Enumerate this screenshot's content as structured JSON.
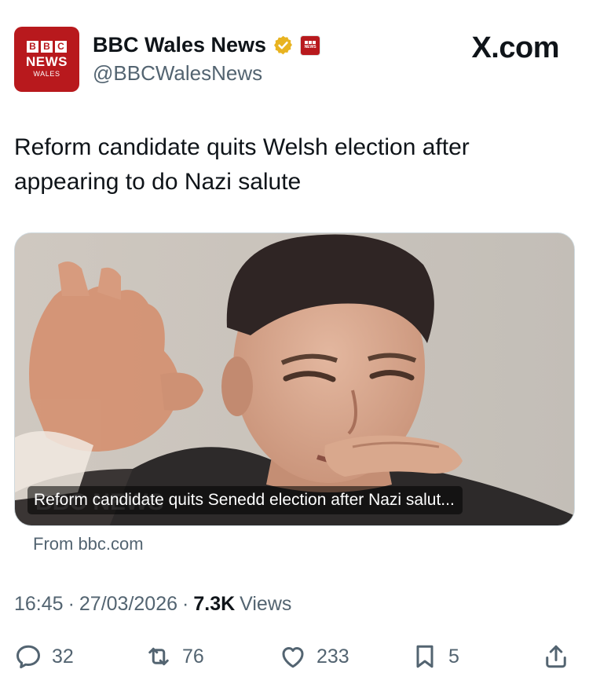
{
  "account": {
    "avatar_blocks": [
      "B",
      "B",
      "C"
    ],
    "avatar_news": "NEWS",
    "avatar_region": "WALES",
    "name": "BBC Wales News",
    "handle": "@BBCWalesNews",
    "verified_icon": "verified-badge-icon",
    "verified_color": "#e8b320",
    "affiliate_label": "NEWS"
  },
  "watermark": "X.com",
  "tweet": {
    "text": "Reform candidate quits Welsh election after appearing to do Nazi salute"
  },
  "link_card": {
    "caption": "Reform candidate quits Senedd election after Nazi salut...",
    "source": "From bbc.com"
  },
  "meta": {
    "time": "16:45",
    "sep1": "·",
    "date": "27/03/2026",
    "sep2": "·",
    "views_count": "7.3K",
    "views_label": "Views"
  },
  "actions": {
    "replies": "32",
    "reposts": "76",
    "likes": "233",
    "bookmarks": "5"
  },
  "colors": {
    "brand_red": "#b8191d",
    "text_primary": "#0f1419",
    "text_secondary": "#536471"
  }
}
